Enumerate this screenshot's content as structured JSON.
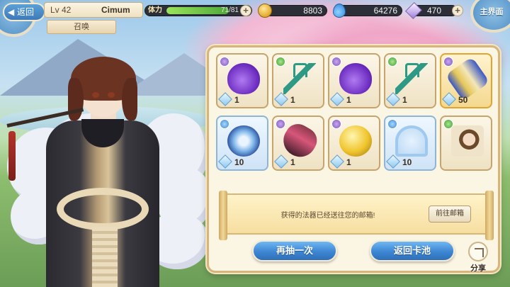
{
  "header": {
    "back_label": "返回",
    "level": "Lv 42",
    "player_name": "Cimum",
    "screen_tag": "召唤",
    "stamina_label": "体力",
    "stamina_value": "71/81",
    "stamina_fraction": 0.877,
    "gold": "8803",
    "water": "64276",
    "crystals": "470",
    "home_label": "主界面"
  },
  "results": {
    "items": [
      {
        "icon": "purple-gourd-icon",
        "count": "1",
        "rank": "purple",
        "frame": "normal"
      },
      {
        "icon": "jade-trident-icon",
        "count": "1",
        "rank": "green",
        "frame": "normal"
      },
      {
        "icon": "purple-gourd-icon",
        "count": "1",
        "rank": "purple",
        "frame": "normal"
      },
      {
        "icon": "jade-trident-icon",
        "count": "1",
        "rank": "green",
        "frame": "normal"
      },
      {
        "icon": "golden-scroll-icon",
        "count": "50",
        "rank": "purple",
        "frame": "gold"
      },
      {
        "icon": "blue-disc-icon",
        "count": "10",
        "rank": "blue",
        "frame": "blue"
      },
      {
        "icon": "crystal-lantern-icon",
        "count": "1",
        "rank": "purple",
        "frame": "normal"
      },
      {
        "icon": "golden-orb-icon",
        "count": "1",
        "rank": "purple",
        "frame": "normal"
      },
      {
        "icon": "ice-bow-icon",
        "count": "10",
        "rank": "blue",
        "frame": "blue"
      },
      {
        "icon": "character-portrait-icon",
        "count": "",
        "rank": "green",
        "frame": "normal"
      }
    ],
    "message": "获得的法器已经送往您的邮箱!",
    "mail_button": "前往邮箱"
  },
  "actions": {
    "draw_again": "再抽一次",
    "back_to_pool": "返回卡池",
    "share": "分享"
  },
  "colors": {
    "panel_border": "#d6b47a",
    "button_blue": "#3d86d3",
    "stamina_green": "#4fa93a"
  }
}
